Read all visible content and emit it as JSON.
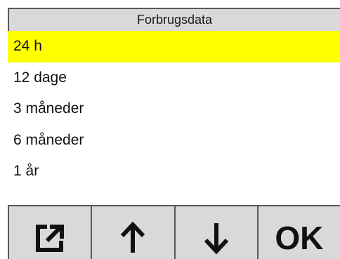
{
  "header": {
    "title": "Forbrugsdata"
  },
  "menu": {
    "items": [
      {
        "label": "24 h",
        "selected": true
      },
      {
        "label": "12 dage",
        "selected": false
      },
      {
        "label": "3 måneder",
        "selected": false
      },
      {
        "label": "6 måneder",
        "selected": false
      },
      {
        "label": "1 år",
        "selected": false
      }
    ]
  },
  "softkeys": {
    "export_icon": "export-icon",
    "up_icon": "arrow-up-icon",
    "down_icon": "arrow-down-icon",
    "ok_label": "OK"
  },
  "colors": {
    "selection": "#ffff00",
    "bar_background": "#d9d9d9",
    "border": "#595959"
  }
}
